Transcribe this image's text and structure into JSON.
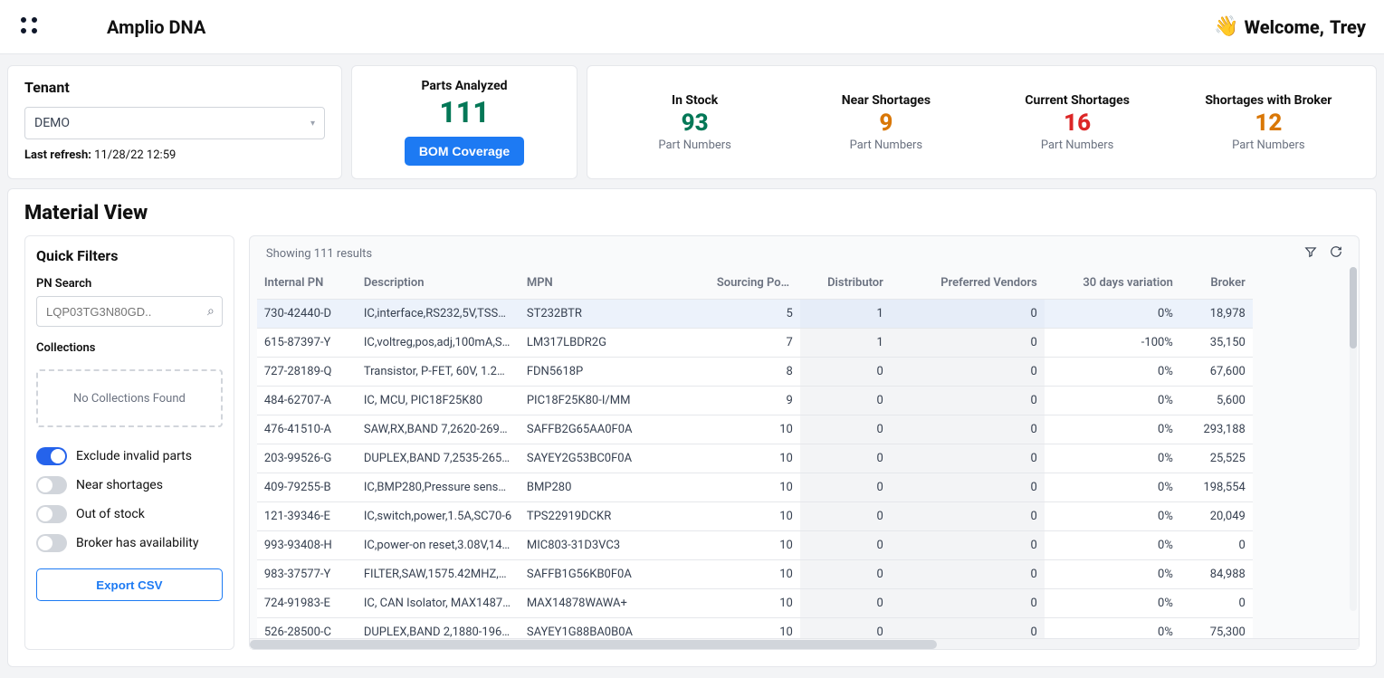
{
  "header": {
    "app_title": "Amplio DNA",
    "welcome_prefix": "Welcome, ",
    "welcome_name": "Trey",
    "wave_emoji": "👋"
  },
  "tenant": {
    "title": "Tenant",
    "selected": "DEMO",
    "refresh_label": "Last refresh:",
    "refresh_value": "11/28/22 12:59"
  },
  "parts_analyzed": {
    "label": "Parts Analyzed",
    "value": "111",
    "button": "BOM Coverage"
  },
  "stats": [
    {
      "title": "In Stock",
      "value": "93",
      "sub": "Part Numbers",
      "color": "c-green"
    },
    {
      "title": "Near Shortages",
      "value": "9",
      "sub": "Part Numbers",
      "color": "c-amber"
    },
    {
      "title": "Current Shortages",
      "value": "16",
      "sub": "Part Numbers",
      "color": "c-red"
    },
    {
      "title": "Shortages with Broker",
      "value": "12",
      "sub": "Part Numbers",
      "color": "c-amber"
    }
  ],
  "material": {
    "heading": "Material View",
    "quick_filters_title": "Quick Filters",
    "pn_search_label": "PN Search",
    "pn_search_placeholder": "LQP03TG3N80GD..",
    "collections_label": "Collections",
    "collections_empty": "No Collections Found",
    "toggles": [
      {
        "label": "Exclude invalid parts",
        "on": true
      },
      {
        "label": "Near shortages",
        "on": false
      },
      {
        "label": "Out of stock",
        "on": false
      },
      {
        "label": "Broker has availability",
        "on": false
      }
    ],
    "export_label": "Export CSV",
    "results_text": "Showing 111 results",
    "columns": [
      "Internal PN",
      "Description",
      "MPN",
      "Sourcing Po…",
      "Distributor",
      "Preferred Vendors",
      "30 days variation",
      "Broker"
    ],
    "sorted_col_index": 3,
    "rows": [
      {
        "sel": true,
        "c0": "730-42440-D",
        "c1": "IC,interface,RS232,5V,TSS…",
        "c2": "ST232BTR",
        "c3": "5",
        "c4": "1",
        "c5": "0",
        "c6": "0%",
        "c7": "18,978"
      },
      {
        "sel": false,
        "c0": "615-87397-Y",
        "c1": "IC,voltreg,pos,adj,100mA,S…",
        "c2": "LM317LBDR2G",
        "c3": "7",
        "c4": "1",
        "c5": "0",
        "c6": "-100%",
        "c7": "35,150"
      },
      {
        "sel": false,
        "c0": "727-28189-Q",
        "c1": "Transistor, P-FET, 60V, 1.2…",
        "c2": "FDN5618P",
        "c3": "8",
        "c4": "0",
        "c5": "0",
        "c6": "0%",
        "c7": "67,600"
      },
      {
        "sel": false,
        "c0": "484-62707-A",
        "c1": "IC, MCU, PIC18F25K80",
        "c2": "PIC18F25K80-I/MM",
        "c3": "9",
        "c4": "0",
        "c5": "0",
        "c6": "0%",
        "c7": "5,600"
      },
      {
        "sel": false,
        "c0": "476-41510-A",
        "c1": "SAW,RX,BAND 7,2620-269…",
        "c2": "SAFFB2G65AA0F0A",
        "c3": "10",
        "c4": "0",
        "c5": "0",
        "c6": "0%",
        "c7": "293,188"
      },
      {
        "sel": false,
        "c0": "203-99526-G",
        "c1": "DUPLEX,BAND 7,2535-265…",
        "c2": "SAYEY2G53BC0F0A",
        "c3": "10",
        "c4": "0",
        "c5": "0",
        "c6": "0%",
        "c7": "25,525"
      },
      {
        "sel": false,
        "c0": "409-79255-B",
        "c1": "IC,BMP280,Pressure sensor…",
        "c2": "BMP280",
        "c3": "10",
        "c4": "0",
        "c5": "0",
        "c6": "0%",
        "c7": "198,554"
      },
      {
        "sel": false,
        "c0": "121-39346-E",
        "c1": "IC,switch,power,1.5A,SC70-6",
        "c2": "TPS22919DCKR",
        "c3": "10",
        "c4": "0",
        "c5": "0",
        "c6": "0%",
        "c7": "20,049"
      },
      {
        "sel": false,
        "c0": "993-93408-H",
        "c1": "IC,power-on reset,3.08V,14…",
        "c2": "MIC803-31D3VC3",
        "c3": "10",
        "c4": "0",
        "c5": "0",
        "c6": "0%",
        "c7": "0"
      },
      {
        "sel": false,
        "c0": "983-37577-Y",
        "c1": "FILTER,SAW,1575.42MHZ,5…",
        "c2": "SAFFB1G56KB0F0A",
        "c3": "10",
        "c4": "0",
        "c5": "0",
        "c6": "0%",
        "c7": "84,988"
      },
      {
        "sel": false,
        "c0": "724-91983-E",
        "c1": "IC, CAN Isolator, MAX1487…",
        "c2": "MAX14878WAWA+",
        "c3": "10",
        "c4": "0",
        "c5": "0",
        "c6": "0%",
        "c7": "0"
      },
      {
        "sel": false,
        "c0": "526-28500-C",
        "c1": "DUPLEX,BAND 2,1880-196…",
        "c2": "SAYEY1G88BA0B0A",
        "c3": "10",
        "c4": "0",
        "c5": "0",
        "c6": "0%",
        "c7": "75,300"
      }
    ]
  }
}
